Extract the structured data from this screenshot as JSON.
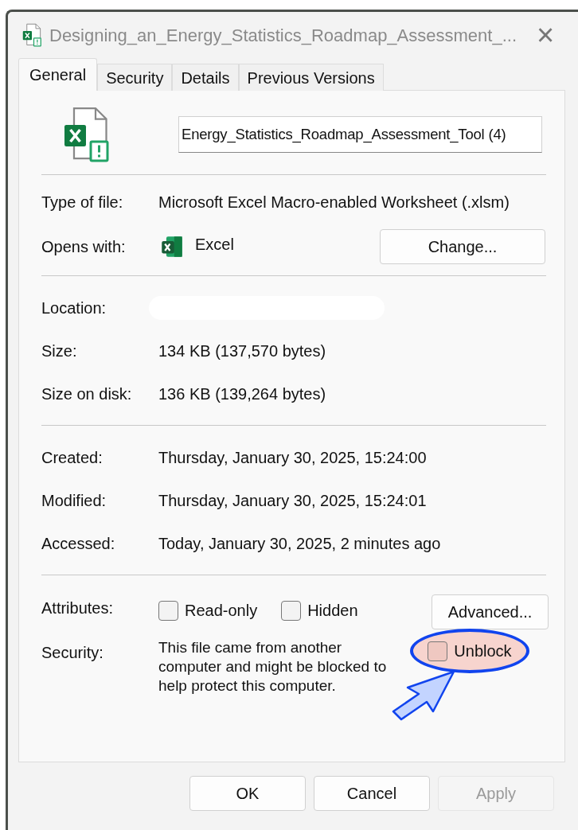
{
  "window": {
    "title": "Designing_an_Energy_Statistics_Roadmap_Assessment_...",
    "close": "×"
  },
  "tabs": [
    {
      "label": "General",
      "selected": true
    },
    {
      "label": "Security",
      "selected": false
    },
    {
      "label": "Details",
      "selected": false
    },
    {
      "label": "Previous Versions",
      "selected": false
    }
  ],
  "file_name": {
    "value": "Energy_Statistics_Roadmap_Assessment_Tool (4)"
  },
  "type_section": [
    {
      "label": "Type of file:",
      "value": "Microsoft Excel Macro-enabled Worksheet (.xlsm)"
    },
    {
      "label": "Opens with:",
      "value": "Excel",
      "button": "Change..."
    }
  ],
  "location_section": [
    {
      "label": "Location:",
      "redacted": true
    },
    {
      "label": "Size:",
      "value": "134 KB (137,570 bytes)"
    },
    {
      "label": "Size on disk:",
      "value": "136 KB (139,264 bytes)"
    }
  ],
  "dates_section": [
    {
      "label": "Created:",
      "value": "Thursday, January 30, 2025, 15:24:00"
    },
    {
      "label": "Modified:",
      "value": "Thursday, January 30, 2025, 15:24:01"
    },
    {
      "label": "Accessed:",
      "value": "Today, January 30, 2025, 2 minutes ago"
    }
  ],
  "attributes": {
    "label": "Attributes:",
    "checkboxes": [
      {
        "label": "Read-only",
        "checked": false
      },
      {
        "label": "Hidden",
        "checked": false
      }
    ],
    "button": "Advanced..."
  },
  "security": {
    "label": "Security:",
    "text": "This file came from another computer and might be blocked to help protect this computer.",
    "unblock": {
      "label": "Unblock",
      "checked": false,
      "highlighted": true
    }
  },
  "buttons": [
    {
      "label": "OK",
      "disabled": false
    },
    {
      "label": "Cancel",
      "disabled": false
    },
    {
      "label": "Apply",
      "disabled": true
    }
  ]
}
